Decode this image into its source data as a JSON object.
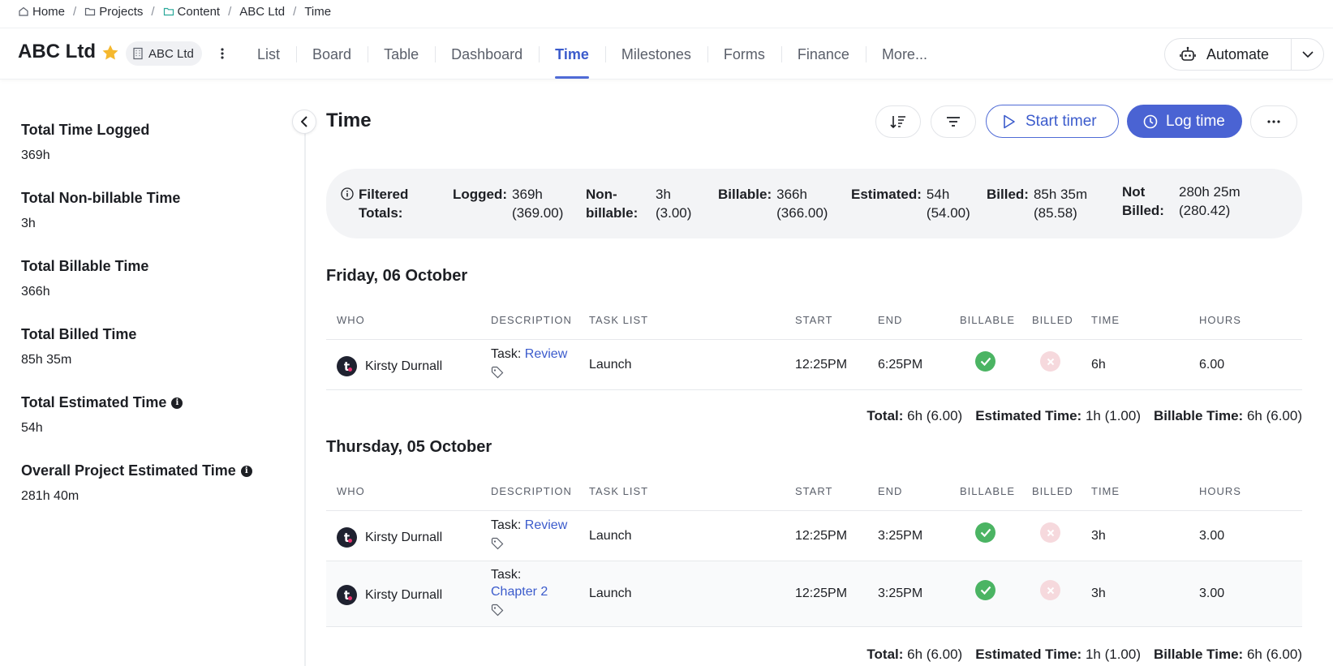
{
  "breadcrumb": {
    "home": "Home",
    "projects": "Projects",
    "content": "Content",
    "company": "ABC Ltd",
    "current": "Time"
  },
  "header": {
    "title": "ABC Ltd",
    "company_chip": "ABC Ltd",
    "tabs": [
      "List",
      "Board",
      "Table",
      "Dashboard",
      "Time",
      "Milestones",
      "Forms",
      "Finance",
      "More..."
    ],
    "active_tab": "Time",
    "automate_label": "Automate"
  },
  "stats": [
    {
      "label": "Total Time Logged",
      "value": "369h",
      "info": false
    },
    {
      "label": "Total Non-billable Time",
      "value": "3h",
      "info": false
    },
    {
      "label": "Total Billable Time",
      "value": "366h",
      "info": false
    },
    {
      "label": "Total Billed Time",
      "value": "85h 35m",
      "info": false
    },
    {
      "label": "Total Estimated Time",
      "value": "54h",
      "info": true
    },
    {
      "label": "Overall Project Estimated Time",
      "value": "281h 40m",
      "info": true
    }
  ],
  "main": {
    "title": "Time",
    "start_timer_label": "Start timer",
    "log_time_label": "Log time"
  },
  "filtered_totals": {
    "label": "Filtered Totals:",
    "logged_k": "Logged:",
    "logged_v": "369h\n(369.00)",
    "nonbillable_k": "Non-\nbillable:",
    "nonbillable_v": "3h\n(3.00)",
    "billable_k": "Billable:",
    "billable_v": "366h\n(366.00)",
    "estimated_k": "Estimated:",
    "estimated_v": "54h\n(54.00)",
    "billed_k": "Billed:",
    "billed_v": "85h 35m\n(85.58)",
    "notbilled_k": "Not\nBilled:",
    "notbilled_v": "280h 25m\n(280.42)"
  },
  "columns": [
    "WHO",
    "DESCRIPTION",
    "TASK LIST",
    "START",
    "END",
    "BILLABLE",
    "BILLED",
    "TIME",
    "HOURS"
  ],
  "days": [
    {
      "title": "Friday, 06 October",
      "rows": [
        {
          "who": "Kirsty Durnall",
          "task_prefix": "Task:",
          "task": "Review",
          "task_list": "Launch",
          "start": "12:25PM",
          "end": "6:25PM",
          "time": "6h",
          "hours": "6.00"
        }
      ],
      "summary": {
        "total_k": "Total:",
        "total_v": "6h (6.00)",
        "est_k": "Estimated Time:",
        "est_v": "1h (1.00)",
        "bill_k": "Billable Time:",
        "bill_v": "6h (6.00)"
      }
    },
    {
      "title": "Thursday, 05 October",
      "rows": [
        {
          "who": "Kirsty Durnall",
          "task_prefix": "Task:",
          "task": "Review",
          "task_list": "Launch",
          "start": "12:25PM",
          "end": "3:25PM",
          "time": "3h",
          "hours": "3.00"
        },
        {
          "who": "Kirsty Durnall",
          "task_prefix": "Task:",
          "task": "Chapter 2",
          "task_list": "Launch",
          "start": "12:25PM",
          "end": "3:25PM",
          "time": "3h",
          "hours": "3.00"
        }
      ],
      "summary": {
        "total_k": "Total:",
        "total_v": "6h (6.00)",
        "est_k": "Estimated Time:",
        "est_v": "1h (1.00)",
        "bill_k": "Billable Time:",
        "bill_v": "6h (6.00)"
      }
    }
  ],
  "colors": {
    "accent": "#4a63d3",
    "check": "#4bb463",
    "billed_x": "#f6d9dd",
    "star": "#f5b82e"
  }
}
